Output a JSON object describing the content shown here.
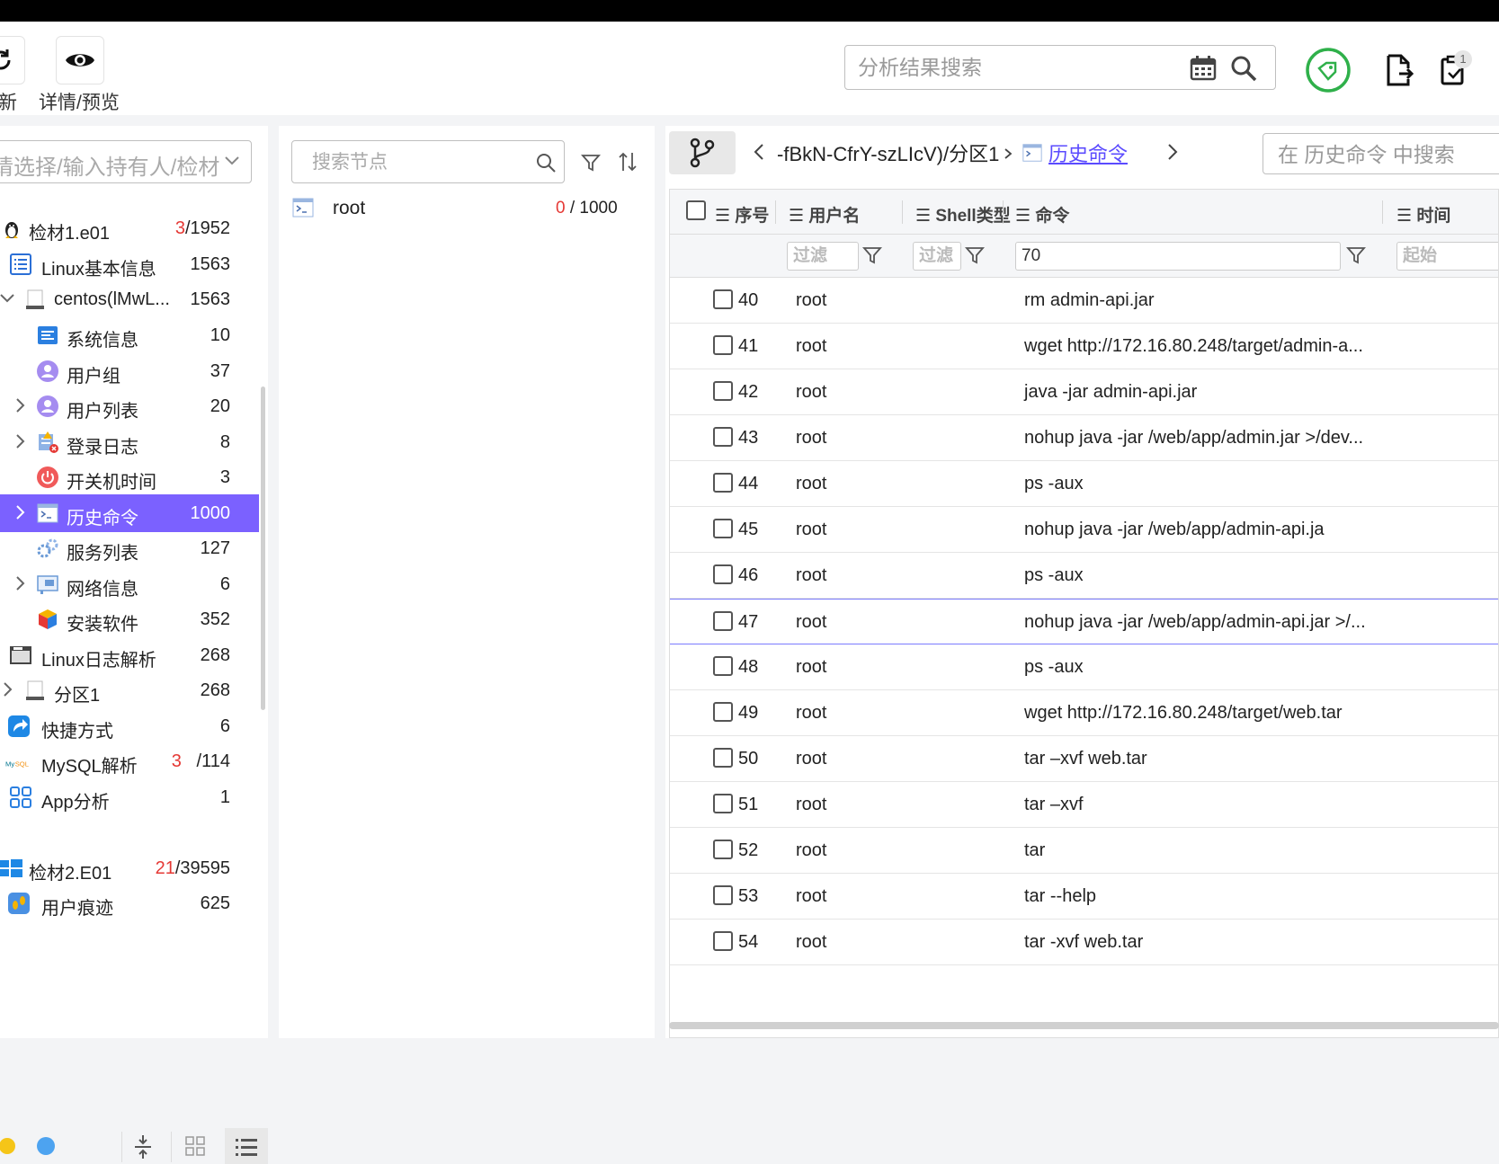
{
  "toolbar": {
    "refresh_label": "新",
    "detail_label": "详情/预览",
    "search_placeholder": "分析结果搜索",
    "notify_count": "1"
  },
  "left": {
    "owner_placeholder": "请选择/输入持有人/检材",
    "items": [
      {
        "label": "检材1.e01",
        "red": "3",
        "count": "/1952"
      },
      {
        "label": "Linux基本信息",
        "red": "",
        "count": "1563"
      },
      {
        "label": "centos(lMwL...",
        "red": "",
        "count": "1563"
      },
      {
        "label": "系统信息",
        "red": "",
        "count": "10"
      },
      {
        "label": "用户组",
        "red": "",
        "count": "37"
      },
      {
        "label": "用户列表",
        "red": "",
        "count": "20"
      },
      {
        "label": "登录日志",
        "red": "",
        "count": "8"
      },
      {
        "label": "开关机时间",
        "red": "",
        "count": "3"
      },
      {
        "label": "历史命令",
        "red": "",
        "count": "1000"
      },
      {
        "label": "服务列表",
        "red": "",
        "count": "127"
      },
      {
        "label": "网络信息",
        "red": "",
        "count": "6"
      },
      {
        "label": "安装软件",
        "red": "",
        "count": "352"
      },
      {
        "label": "Linux日志解析",
        "red": "",
        "count": "268"
      },
      {
        "label": "分区1",
        "red": "",
        "count": "268"
      },
      {
        "label": "快捷方式",
        "red": "",
        "count": "6"
      },
      {
        "label": "MySQL解析",
        "red": "3",
        "count": " /114"
      },
      {
        "label": "App分析",
        "red": "",
        "count": "1"
      },
      {
        "label": "检材2.E01",
        "red": "21",
        "count": "/39595"
      },
      {
        "label": "用户痕迹",
        "red": "",
        "count": "625"
      }
    ]
  },
  "middle": {
    "search_placeholder": "搜索节点",
    "node_label": "root",
    "node_red": "0",
    "node_count": " / 1000"
  },
  "right": {
    "crumb_path": "-fBkN-CfrY-szLIcV)/分区1",
    "crumb_current": "历史命令",
    "search_placeholder": "在 历史命令 中搜索",
    "headers": {
      "seq": "序号",
      "user": "用户名",
      "shell": "Shell类型",
      "cmd": "命令",
      "time": "时间"
    },
    "filter": {
      "placeholder": "过滤",
      "cmd_value": "70",
      "time_placeholder": "起始"
    },
    "rows": [
      {
        "seq": "40",
        "user": "root",
        "cmd": "rm admin-api.jar"
      },
      {
        "seq": "41",
        "user": "root",
        "cmd": "wget http://172.16.80.248/target/admin-a..."
      },
      {
        "seq": "42",
        "user": "root",
        "cmd": "java -jar admin-api.jar"
      },
      {
        "seq": "43",
        "user": "root",
        "cmd": "nohup java -jar /web/app/admin.jar >/dev..."
      },
      {
        "seq": "44",
        "user": "root",
        "cmd": "ps -aux"
      },
      {
        "seq": "45",
        "user": "root",
        "cmd": "nohup java -jar /web/app/admin-api.ja"
      },
      {
        "seq": "46",
        "user": "root",
        "cmd": "ps -aux"
      },
      {
        "seq": "47",
        "user": "root",
        "cmd": "nohup java -jar /web/app/admin-api.jar >/..."
      },
      {
        "seq": "48",
        "user": "root",
        "cmd": "ps -aux"
      },
      {
        "seq": "49",
        "user": "root",
        "cmd": "wget http://172.16.80.248/target/web.tar"
      },
      {
        "seq": "50",
        "user": "root",
        "cmd": "tar –xvf web.tar"
      },
      {
        "seq": "51",
        "user": "root",
        "cmd": "tar –xvf"
      },
      {
        "seq": "52",
        "user": "root",
        "cmd": "tar"
      },
      {
        "seq": "53",
        "user": "root",
        "cmd": "tar --help"
      },
      {
        "seq": "54",
        "user": "root",
        "cmd": "tar -xvf web.tar"
      }
    ]
  },
  "colors": {
    "accent": "#7b61ff",
    "green": "#2fb04a",
    "red": "#e53935",
    "link": "#5b4bff"
  }
}
